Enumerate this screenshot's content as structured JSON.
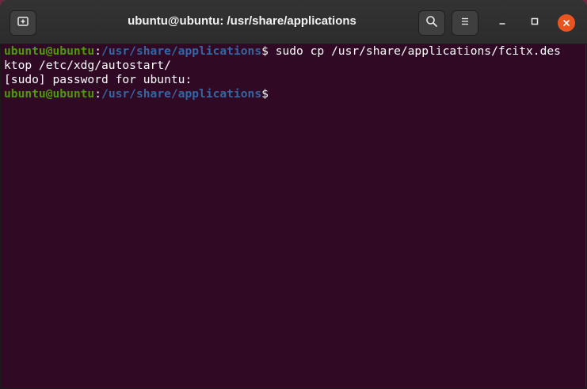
{
  "window": {
    "title": "ubuntu@ubuntu: /usr/share/applications"
  },
  "titlebar_buttons": {
    "new_tab_icon": "new-tab-icon",
    "search_icon": "search-icon",
    "menu_icon": "hamburger-menu-icon",
    "minimize_icon": "minimize-icon",
    "maximize_icon": "maximize-icon",
    "close_icon": "close-icon"
  },
  "colors": {
    "terminal_bg": "#300a24",
    "prompt_user": "#4e9a06",
    "prompt_path": "#3465a4",
    "close_button": "#e95420"
  },
  "terminal": {
    "line1": {
      "user_host": "ubuntu@ubuntu",
      "colon": ":",
      "path": "/usr/share/applications",
      "dollar": "$ ",
      "command": "sudo cp /usr/share/applications/fcitx.des"
    },
    "line2": "ktop /etc/xdg/autostart/",
    "line3": "[sudo] password for ubuntu:",
    "line4": {
      "user_host": "ubuntu@ubuntu",
      "colon": ":",
      "path": "/usr/share/applications",
      "dollar": "$"
    }
  }
}
